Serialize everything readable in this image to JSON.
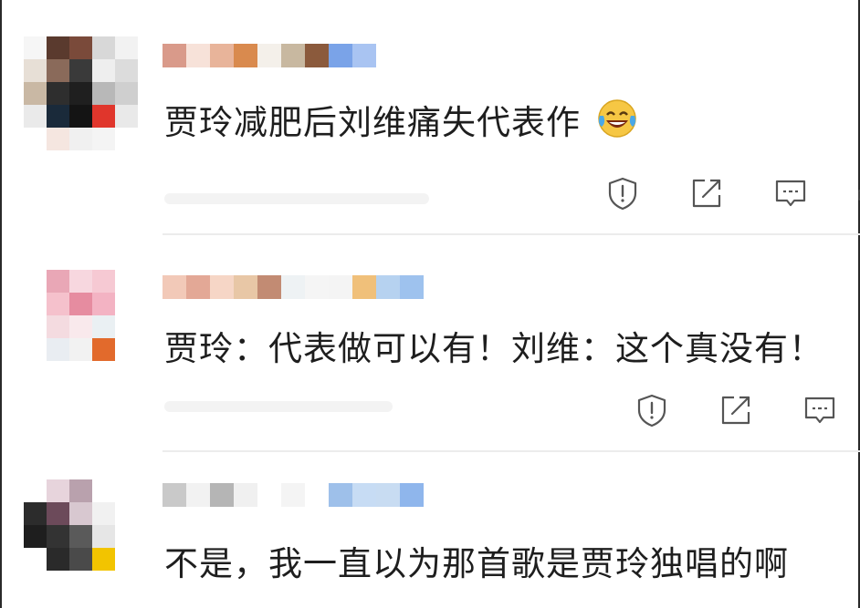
{
  "comments": [
    {
      "text": "贾玲减肥后刘维痛失代表作",
      "emoji": "laughing-with-tears-icon",
      "avatar_colors": [
        "#f6f6f6",
        "#5a3a2e",
        "#7a4a3a",
        "#d8d8d8",
        "#f2f2f2",
        "#e7dfd6",
        "#8a6a5a",
        "#3a3a3a",
        "#eeeeee",
        "#dcdcdc",
        "#c9b8a4",
        "#2e2e2e",
        "#1f1f1f",
        "#b8b8b8",
        "#cfcfcf",
        "#eaeaea",
        "#1a2a3a",
        "#141414",
        "#e0362c",
        "#e9e9e9",
        "#ffffff",
        "#f5e6e0",
        "#f0f0f0",
        "#f4f4f4",
        "#ffffff"
      ],
      "username_colors": [
        "#d99a8a",
        "#f7e2d9",
        "#e8b49a",
        "#d98a4e",
        "#f4f0ea",
        "#c8b8a0",
        "#8b5a3c",
        "#7aa3e8",
        "#a9c4f2"
      ]
    },
    {
      "text": "贾玲：代表做可以有！刘维：这个真没有！",
      "avatar_colors": [
        "#ffffff",
        "#e9a7b6",
        "#f7d7df",
        "#f6c9d3",
        "#ffffff",
        "#ffffff",
        "#f5c1cc",
        "#e68ca0",
        "#f3b3c3",
        "#ffffff",
        "#ffffff",
        "#f4dbe0",
        "#f9e9ec",
        "#eaf0f3",
        "#ffffff",
        "#ffffff",
        "#e9edf2",
        "#f2f2f2",
        "#e26a2c",
        "#ffffff",
        "#ffffff",
        "#ffffff",
        "#ffffff",
        "#ffffff",
        "#ffffff"
      ],
      "username_colors": [
        "#f2c9b8",
        "#e3a896",
        "#f6d6c6",
        "#e8c7a6",
        "#c28b73",
        "#eef2f4",
        "#f5f5f5",
        "#f4f4f4",
        "#f0c07a",
        "#b6d2f0",
        "#9ec2ee"
      ]
    },
    {
      "text": "不是，我一直以为那首歌是贾玲独唱的啊",
      "avatar_colors": [
        "#ffffff",
        "#e7d4dc",
        "#b9a1ad",
        "#ffffff",
        "#ffffff",
        "#2c2c2c",
        "#6c4a5a",
        "#d8c8d0",
        "#f1f1f1",
        "#ffffff",
        "#1e1e1e",
        "#333333",
        "#5a5a5a",
        "#e6e6e6",
        "#ffffff",
        "#ffffff",
        "#2a2a2a",
        "#4a4a4a",
        "#f2c400",
        "#ffffff",
        "#ffffff",
        "#ffffff",
        "#ffffff",
        "#ffffff",
        "#ffffff"
      ],
      "username_colors": [
        "#c9c9c9",
        "#f2f2f2",
        "#b5b5b5",
        "#f0f0f0",
        "#ffffff",
        "#f4f4f4",
        "#ffffff",
        "#9ec0ea",
        "#c7dcf4",
        "#c8dcf2",
        "#8fb6ec"
      ]
    }
  ],
  "actions": {
    "report_icon": "shield-exclamation-icon",
    "share_icon": "share-external-icon",
    "reply_icon": "comment-bubble-icon"
  }
}
